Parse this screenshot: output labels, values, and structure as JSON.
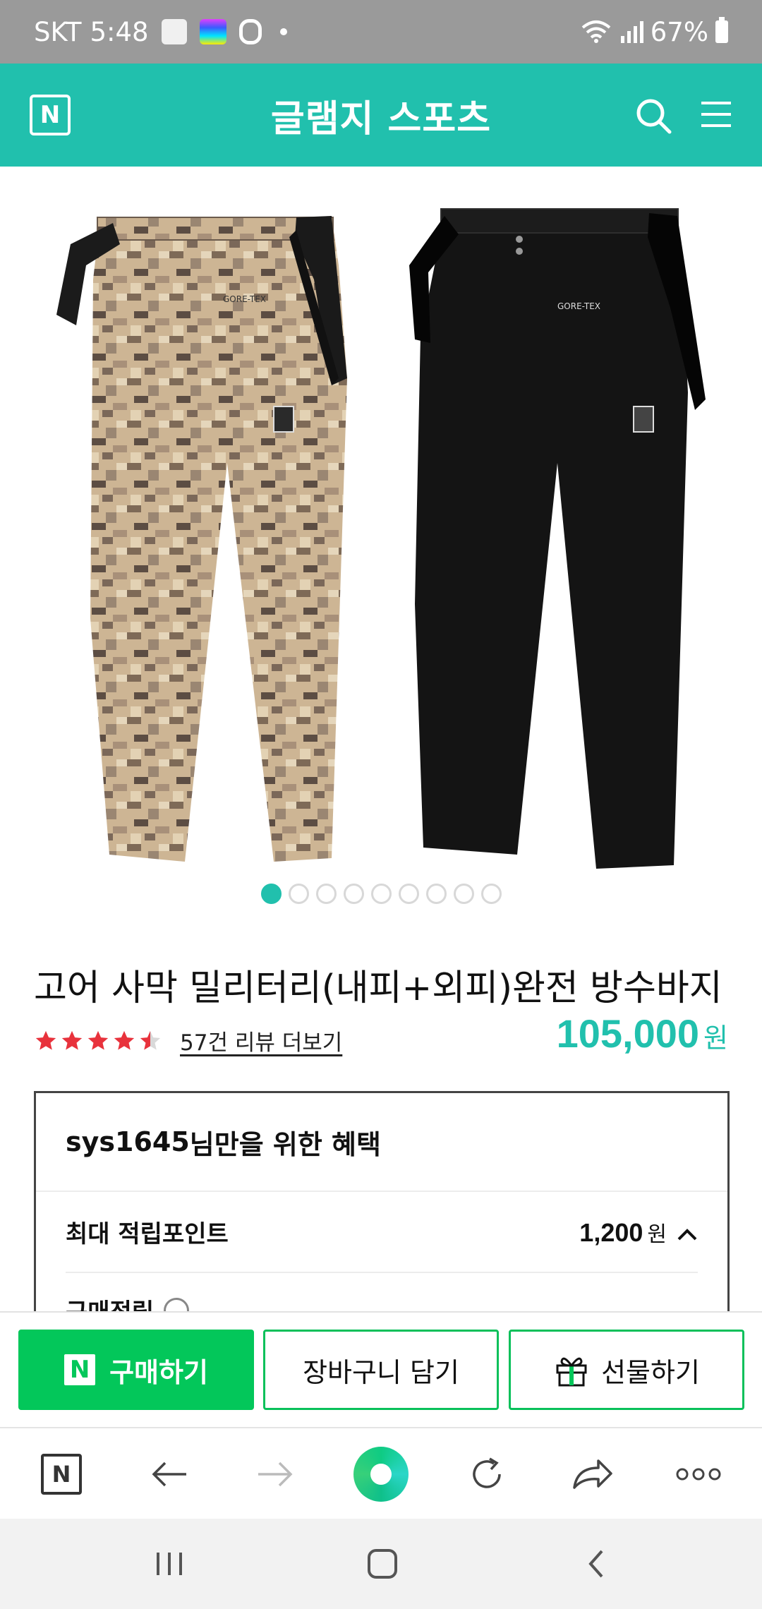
{
  "status_bar": {
    "carrier": "SKT",
    "time": "5:48",
    "battery": "67%",
    "icons": [
      "notification-app-icon",
      "equalizer-app-icon",
      "b-app-icon",
      "wifi-icon",
      "signal-icon",
      "battery-icon"
    ]
  },
  "header": {
    "logo": "N",
    "store_name": "글램지 스포츠",
    "icons": [
      "search-icon",
      "menu-icon"
    ],
    "color": "#21c0ad"
  },
  "gallery": {
    "current_page": 1,
    "total_pages": 9
  },
  "product": {
    "name": "고어 사막 밀리터리(내피+외피)완전 방수바지",
    "rating": 4.5,
    "review_link": "57건 리뷰 더보기",
    "price": "105,000",
    "price_unit": "원"
  },
  "benefit": {
    "user_id": "sys1645",
    "title_suffix": "님만을 위한 혜택",
    "point_label": "최대 적립포인트",
    "point_value": "1,200",
    "point_unit": "원",
    "next_label": "구매적립"
  },
  "actions": {
    "buy_label": "구매하기",
    "cart_label": "장바구니 담기",
    "gift_label": "선물하기",
    "buy_color": "#03c75a"
  },
  "browser_toolbar": {
    "home_logo": "N",
    "icons": [
      "naver-home-icon",
      "back-arrow-icon",
      "forward-arrow-icon",
      "green-dot-icon",
      "refresh-icon",
      "share-icon",
      "more-icon"
    ]
  },
  "nav_bar": {
    "icons": [
      "recent-apps-icon",
      "home-icon",
      "back-icon"
    ]
  }
}
